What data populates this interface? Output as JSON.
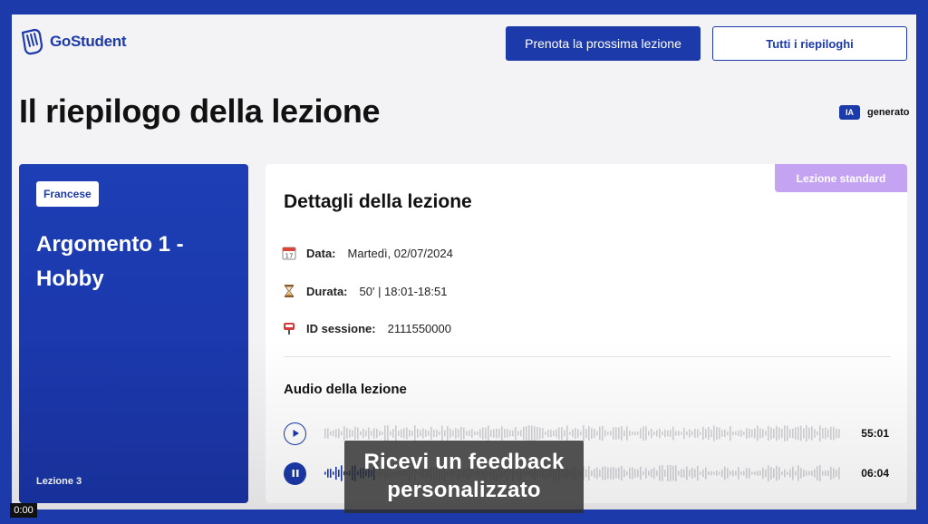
{
  "header": {
    "logo_text": "GoStudent",
    "book_next_label": "Prenota la prossima lezione",
    "all_summaries_label": "Tutti i riepiloghi"
  },
  "page": {
    "title": "Il riepilogo della lezione",
    "ai_tag": "IA",
    "ai_label": "generato"
  },
  "topic_card": {
    "subject": "Francese",
    "topic": "Argomento 1 - Hobby",
    "lesson_number": "Lezione 3"
  },
  "details": {
    "lesson_type": "Lezione standard",
    "heading": "Dettagli della lezione",
    "date_label": "Data:",
    "date_value": "Martedì, 02/07/2024",
    "duration_label": "Durata:",
    "duration_value": "50' | 18:01-18:51",
    "session_label": "ID sessione:",
    "session_value": "2111550000"
  },
  "audio": {
    "heading": "Audio della lezione",
    "tracks": [
      {
        "state": "paused",
        "time": "55:01",
        "progress": 0
      },
      {
        "state": "playing",
        "time": "06:04",
        "progress": 0.1
      }
    ]
  },
  "video": {
    "subtitle": "Ricevi un feedback personalizzato",
    "timecode": "0:00"
  },
  "colors": {
    "brand_blue": "#1c3aa9",
    "lesson_type_purple": "#c4a3f3",
    "wave_inactive": "#d3d3d8",
    "wave_active": "#1c3aa9"
  },
  "icons": {
    "date": "calendar-icon",
    "duration": "hourglass-icon",
    "session": "mailbox-icon"
  }
}
